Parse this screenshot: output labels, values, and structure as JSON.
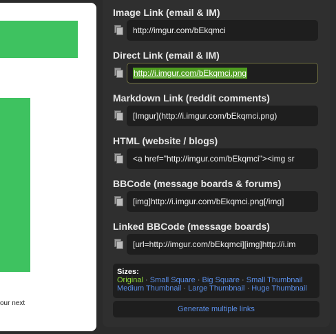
{
  "preview": {
    "caption": "our next"
  },
  "links": {
    "image": {
      "label": "Image Link (email & IM)",
      "value": "http://imgur.com/bEkqmci"
    },
    "direct": {
      "label": "Direct Link (email & IM)",
      "value": "http://i.imgur.com/bEkqmci.png"
    },
    "markdown": {
      "label": "Markdown Link (reddit comments)",
      "value": "[Imgur](http://i.imgur.com/bEkqmci.png)"
    },
    "html": {
      "label": "HTML (website / blogs)",
      "value": "<a href=\"http://imgur.com/bEkqmci\"><img sr"
    },
    "bbcode": {
      "label": "BBCode (message boards & forums)",
      "value": "[img]http://i.imgur.com/bEkqmci.png[/img]"
    },
    "linked_bbcode": {
      "label": "Linked BBCode (message boards)",
      "value": "[url=http://imgur.com/bEkqmci][img]http://i.im"
    }
  },
  "sizes": {
    "title": "Sizes:",
    "separator": "·",
    "items": [
      "Original",
      "Small Square",
      "Big Square",
      "Small Thumbnail",
      "Medium Thumbnail",
      "Large Thumbnail",
      "Huge Thumbnail"
    ]
  },
  "actions": {
    "generate_label": "Generate multiple links"
  },
  "colors": {
    "panel": "#2f2f2f",
    "field": "#1e1e1e",
    "link": "#5a8ee8",
    "active_size": "#8fdc3a",
    "selection": "#4f9d20",
    "preview_green": "#3ec260"
  }
}
